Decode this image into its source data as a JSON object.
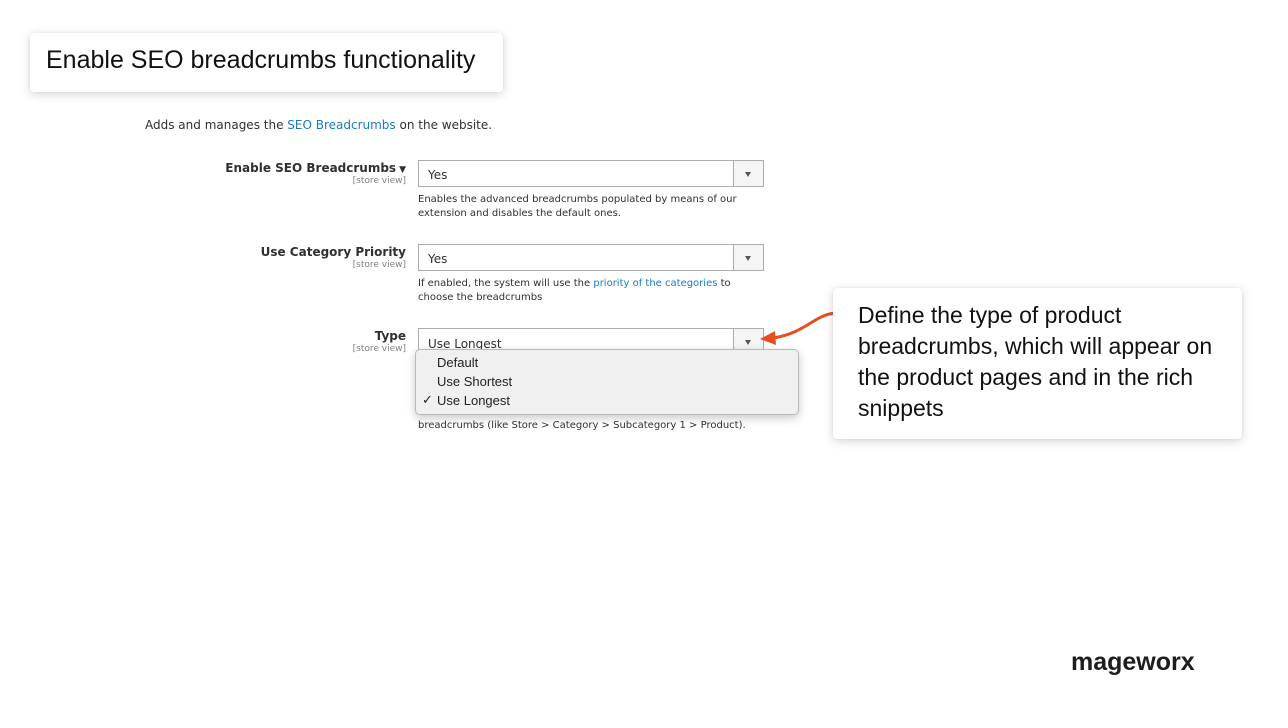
{
  "header_card": {
    "title": "Enable SEO breadcrumbs functionality"
  },
  "intro": {
    "prefix": "Adds and manages the ",
    "link": "SEO Breadcrumbs",
    "suffix": " on the website."
  },
  "fields": {
    "enable": {
      "label": "Enable SEO Breadcrumbs",
      "scope": "[store view]",
      "value": "Yes",
      "note": "Enables the advanced breadcrumbs populated by means of our extension and disables the default ones."
    },
    "category_priority": {
      "label": "Use Category Priority",
      "scope": "[store view]",
      "value": "Yes",
      "note_prefix": "If enabled, the system will use the ",
      "note_link": "priority of the categories",
      "note_suffix": " to choose the breadcrumbs"
    },
    "type": {
      "label": "Type",
      "scope": "[store view]",
      "value": "Use Longest",
      "note": "breadcrumbs (like Store > Category > Subcategory 1 > Product).",
      "options": [
        {
          "label": "Default",
          "checked": false
        },
        {
          "label": "Use Shortest",
          "checked": false
        },
        {
          "label": "Use Longest",
          "checked": true
        }
      ],
      "check_mark": "✓"
    }
  },
  "callout": {
    "text": "Define the type of product breadcrumbs, which will appear on the product pages and in the rich snippets"
  },
  "brand": {
    "logo": "mageworx"
  },
  "colors": {
    "link": "#1979c3",
    "arrow": "#ea4e1f"
  }
}
